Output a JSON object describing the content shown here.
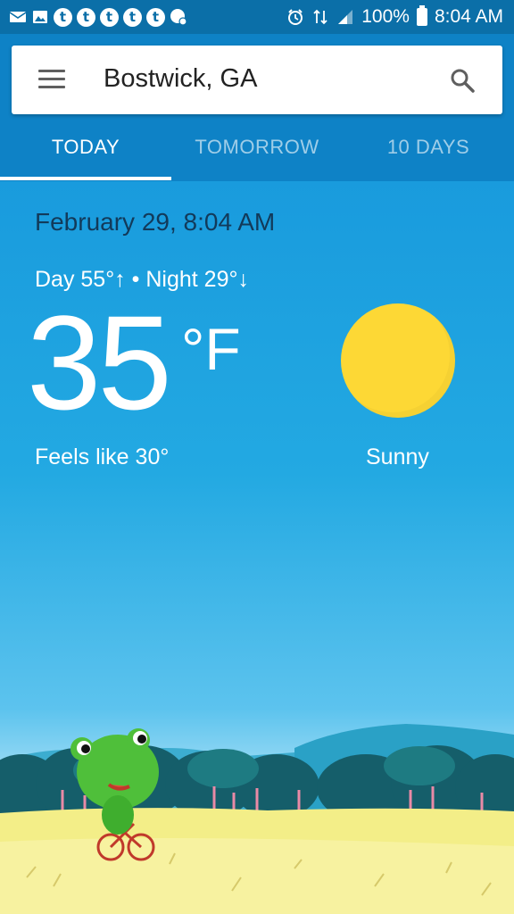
{
  "status_bar": {
    "battery": "100%",
    "time": "8:04 AM",
    "notification_icons": [
      "mail-icon",
      "image-icon",
      "tumblr-icon",
      "tumblr-icon",
      "tumblr-icon",
      "tumblr-icon",
      "tumblr-icon",
      "chat-icon"
    ],
    "system_icons": [
      "alarm-icon",
      "data-icon",
      "signal-icon",
      "battery-icon"
    ]
  },
  "search": {
    "location": "Bostwick, GA",
    "menu_icon": "hamburger-menu-icon",
    "search_icon": "search-icon"
  },
  "tabs": [
    {
      "label": "TODAY",
      "active": true
    },
    {
      "label": "TOMORROW",
      "active": false
    },
    {
      "label": "10 DAYS",
      "active": false
    }
  ],
  "weather": {
    "datetime": "February 29, 8:04 AM",
    "day_night": "Day 55°↑ • Night 29°↓",
    "temperature": "35",
    "unit": "°F",
    "feels_like": "Feels like 30°",
    "condition": "Sunny",
    "condition_icon": "sun-icon"
  },
  "colors": {
    "header": "#0e82c6",
    "status_bar": "#0b6fa8",
    "sky_top": "#199bdd",
    "sun": "#fdd835"
  }
}
